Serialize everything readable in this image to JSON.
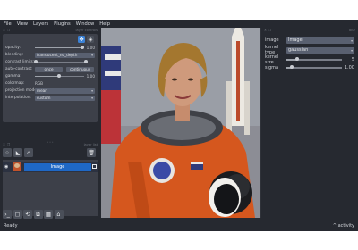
{
  "menu": [
    {
      "label": "File"
    },
    {
      "label": "View"
    },
    {
      "label": "Layers"
    },
    {
      "label": "Plugins"
    },
    {
      "label": "Window"
    },
    {
      "label": "Help"
    }
  ],
  "layer_controls": {
    "dock_title": "layer controls",
    "opacity": {
      "label": "opacity:",
      "value": "1.00",
      "level": 0.97
    },
    "blending": {
      "label": "blending:",
      "value": "translucent_no_depth"
    },
    "contrast_limits": {
      "label": "contrast limits:",
      "low": 0.0,
      "high": 1.0
    },
    "auto_contrast": {
      "label": "auto-contrast:",
      "once": "once",
      "continuous": "continuous"
    },
    "gamma": {
      "label": "gamma:",
      "value": "1.00",
      "level": 0.5
    },
    "colormap": {
      "label": "colormap:",
      "value": "RGB"
    },
    "projection_mode": {
      "label": "projection mode:",
      "value": "mean"
    },
    "interpolation": {
      "label": "interpolation:",
      "value": "custom"
    }
  },
  "layer_list": {
    "dock_title": "layer list",
    "layers": [
      {
        "name": "Image",
        "visible": true
      }
    ]
  },
  "plugin_widget": {
    "dock_title": "blur",
    "image": {
      "label": "image",
      "value": "Image"
    },
    "kernel_type": {
      "label": "kernel type",
      "value": "gaussian"
    },
    "kernel_size": {
      "label": "kernel size",
      "value": "5",
      "level": 0.2
    },
    "sigma": {
      "label": "sigma",
      "value": "1.00",
      "level": 0.1
    }
  },
  "status": {
    "left": "Ready",
    "right": "activity",
    "right_icon": "chevron-up-icon"
  },
  "colors": {
    "window_bg": "#262930",
    "panel_bg": "#3d4049",
    "accent": "#1f68c5",
    "dropdown_bg": "#596070"
  }
}
